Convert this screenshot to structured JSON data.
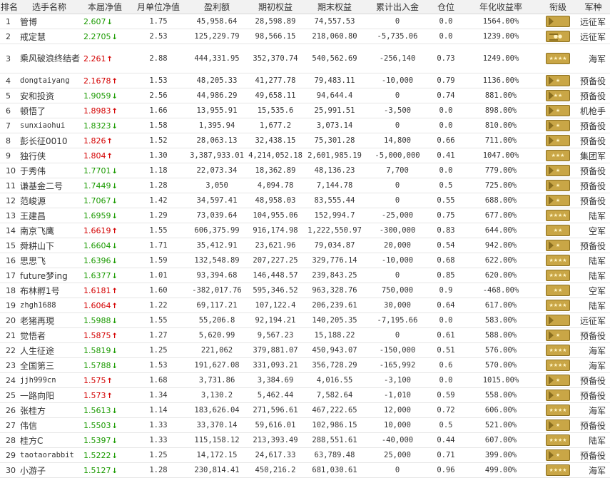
{
  "columns": [
    "排名",
    "选手名称",
    "本届净值",
    "月单位净值",
    "盈利额",
    "期初权益",
    "期末权益",
    "累计出入金",
    "仓位",
    "年化收益率",
    "衔级",
    "军种"
  ],
  "rows": [
    {
      "rank": "1",
      "name": "管博",
      "nav": "2.607",
      "dir": "down",
      "monthly": "1.75",
      "profit": "45,958.64",
      "start": "28,598.89",
      "end": "74,557.53",
      "flow": "0",
      "position": "0.0",
      "annual": "1564.00%",
      "badge": "chev-plain",
      "corps": "远征军"
    },
    {
      "rank": "2",
      "name": "戒定慧",
      "nav": "2.2705",
      "dir": "down",
      "monthly": "2.53",
      "profit": "125,229.79",
      "start": "98,566.15",
      "end": "218,060.80",
      "flow": "-5,735.06",
      "position": "0.0",
      "annual": "1239.00%",
      "badge": "bars-2",
      "corps": "远征军"
    },
    {
      "rank": "3",
      "name": "乘风破浪终结者",
      "nav": "2.261",
      "dir": "up",
      "monthly": "2.88",
      "profit": "444,331.95",
      "start": "352,370.74",
      "end": "540,562.69",
      "flow": "-256,140",
      "position": "0.73",
      "annual": "1249.00%",
      "badge": "stars-4",
      "corps": "海军",
      "tall": true
    },
    {
      "rank": "4",
      "name": "dongtaiyang",
      "nav": "2.1678",
      "dir": "up",
      "monthly": "1.53",
      "profit": "48,205.33",
      "start": "41,277.78",
      "end": "79,483.11",
      "flow": "-10,000",
      "position": "0.79",
      "annual": "1136.00%",
      "badge": "chev-1",
      "corps": "预备役",
      "latin": true
    },
    {
      "rank": "5",
      "name": "安和投资",
      "nav": "1.9059",
      "dir": "down",
      "monthly": "2.56",
      "profit": "44,986.29",
      "start": "49,658.11",
      "end": "94,644.4",
      "flow": "0",
      "position": "0.74",
      "annual": "881.00%",
      "badge": "chev-2",
      "corps": "预备役"
    },
    {
      "rank": "6",
      "name": "顿悟了",
      "nav": "1.8983",
      "dir": "up",
      "monthly": "1.66",
      "profit": "13,955.91",
      "start": "15,535.6",
      "end": "25,991.51",
      "flow": "-3,500",
      "position": "0.0",
      "annual": "898.00%",
      "badge": "chev-1",
      "corps": "机枪手"
    },
    {
      "rank": "7",
      "name": "sunxiaohui",
      "nav": "1.8323",
      "dir": "down",
      "monthly": "1.58",
      "profit": "1,395.94",
      "start": "1,677.2",
      "end": "3,073.14",
      "flow": "0",
      "position": "0.0",
      "annual": "810.00%",
      "badge": "chev-1",
      "corps": "预备役",
      "latin": true
    },
    {
      "rank": "8",
      "name": "彭长征0010",
      "nav": "1.826",
      "dir": "up",
      "monthly": "1.52",
      "profit": "28,063.13",
      "start": "32,438.15",
      "end": "75,301.28",
      "flow": "14,800",
      "position": "0.66",
      "annual": "711.00%",
      "badge": "chev-1",
      "corps": "预备役"
    },
    {
      "rank": "9",
      "name": "独行侠",
      "nav": "1.804",
      "dir": "up",
      "monthly": "1.30",
      "profit": "3,387,933.01",
      "start": "4,214,052.18",
      "end": "2,601,985.19",
      "flow": "-5,000,000",
      "position": "0.41",
      "annual": "1047.00%",
      "badge": "stars-3",
      "corps": "集团军"
    },
    {
      "rank": "10",
      "name": "于秀伟",
      "nav": "1.7701",
      "dir": "down",
      "monthly": "1.18",
      "profit": "22,073.34",
      "start": "18,362.89",
      "end": "48,136.23",
      "flow": "7,700",
      "position": "0.0",
      "annual": "779.00%",
      "badge": "chev-1",
      "corps": "预备役"
    },
    {
      "rank": "11",
      "name": "谦基金二号",
      "nav": "1.7449",
      "dir": "down",
      "monthly": "1.28",
      "profit": "3,050",
      "start": "4,094.78",
      "end": "7,144.78",
      "flow": "0",
      "position": "0.5",
      "annual": "725.00%",
      "badge": "chev-1",
      "corps": "预备役"
    },
    {
      "rank": "12",
      "name": "范峻源",
      "nav": "1.7067",
      "dir": "down",
      "monthly": "1.42",
      "profit": "34,597.41",
      "start": "48,958.03",
      "end": "83,555.44",
      "flow": "0",
      "position": "0.55",
      "annual": "688.00%",
      "badge": "chev-1",
      "corps": "预备役"
    },
    {
      "rank": "13",
      "name": "王建昌",
      "nav": "1.6959",
      "dir": "down",
      "monthly": "1.29",
      "profit": "73,039.64",
      "start": "104,955.06",
      "end": "152,994.7",
      "flow": "-25,000",
      "position": "0.75",
      "annual": "677.00%",
      "badge": "stars-4",
      "corps": "陆军"
    },
    {
      "rank": "14",
      "name": "南京飞鹰",
      "nav": "1.6619",
      "dir": "up",
      "monthly": "1.55",
      "profit": "606,375.99",
      "start": "916,174.98",
      "end": "1,222,550.97",
      "flow": "-300,000",
      "position": "0.83",
      "annual": "644.00%",
      "badge": "stars-2",
      "corps": "空军"
    },
    {
      "rank": "15",
      "name": "舜耕山下",
      "nav": "1.6604",
      "dir": "down",
      "monthly": "1.71",
      "profit": "35,412.91",
      "start": "23,621.96",
      "end": "79,034.87",
      "flow": "20,000",
      "position": "0.54",
      "annual": "942.00%",
      "badge": "chev-1",
      "corps": "预备役"
    },
    {
      "rank": "16",
      "name": "思思飞",
      "nav": "1.6396",
      "dir": "down",
      "monthly": "1.59",
      "profit": "132,548.89",
      "start": "207,227.25",
      "end": "329,776.14",
      "flow": "-10,000",
      "position": "0.68",
      "annual": "622.00%",
      "badge": "stars-4",
      "corps": "陆军"
    },
    {
      "rank": "17",
      "name": "future梦ing",
      "nav": "1.6377",
      "dir": "down",
      "monthly": "1.01",
      "profit": "93,394.68",
      "start": "146,448.57",
      "end": "239,843.25",
      "flow": "0",
      "position": "0.85",
      "annual": "620.00%",
      "badge": "stars-4",
      "corps": "陆军"
    },
    {
      "rank": "18",
      "name": "布林孵1号",
      "nav": "1.6181",
      "dir": "up",
      "monthly": "1.60",
      "profit": "-382,017.76",
      "start": "595,346.52",
      "end": "963,328.76",
      "flow": "750,000",
      "position": "0.9",
      "annual": "-468.00%",
      "badge": "stars-2",
      "corps": "空军"
    },
    {
      "rank": "19",
      "name": "zhgh1688",
      "nav": "1.6064",
      "dir": "up",
      "monthly": "1.22",
      "profit": "69,117.21",
      "start": "107,122.4",
      "end": "206,239.61",
      "flow": "30,000",
      "position": "0.64",
      "annual": "617.00%",
      "badge": "stars-4",
      "corps": "陆军",
      "latin": true
    },
    {
      "rank": "20",
      "name": "老猪再現",
      "nav": "1.5988",
      "dir": "down",
      "monthly": "1.55",
      "profit": "55,206.8",
      "start": "92,194.21",
      "end": "140,205.35",
      "flow": "-7,195.66",
      "position": "0.0",
      "annual": "583.00%",
      "badge": "chev-plain",
      "corps": "远征军"
    },
    {
      "rank": "21",
      "name": "觉悟者",
      "nav": "1.5875",
      "dir": "up",
      "monthly": "1.27",
      "profit": "5,620.99",
      "start": "9,567.23",
      "end": "15,188.22",
      "flow": "0",
      "position": "0.61",
      "annual": "588.00%",
      "badge": "chev-1",
      "corps": "预备役"
    },
    {
      "rank": "22",
      "name": "人生征途",
      "nav": "1.5819",
      "dir": "down",
      "monthly": "1.25",
      "profit": "221,062",
      "start": "379,881.07",
      "end": "450,943.07",
      "flow": "-150,000",
      "position": "0.51",
      "annual": "576.00%",
      "badge": "stars-4",
      "corps": "海军"
    },
    {
      "rank": "23",
      "name": "全国第三",
      "nav": "1.5788",
      "dir": "down",
      "monthly": "1.53",
      "profit": "191,627.08",
      "start": "331,093.21",
      "end": "356,728.29",
      "flow": "-165,992",
      "position": "0.6",
      "annual": "570.00%",
      "badge": "stars-4",
      "corps": "海军"
    },
    {
      "rank": "24",
      "name": "jjh999cn",
      "nav": "1.575",
      "dir": "up",
      "monthly": "1.68",
      "profit": "3,731.86",
      "start": "3,384.69",
      "end": "4,016.55",
      "flow": "-3,100",
      "position": "0.0",
      "annual": "1015.00%",
      "badge": "chev-1",
      "corps": "预备役",
      "latin": true
    },
    {
      "rank": "25",
      "name": "一路向阳",
      "nav": "1.573",
      "dir": "up",
      "monthly": "1.34",
      "profit": "3,130.2",
      "start": "5,462.44",
      "end": "7,582.64",
      "flow": "-1,010",
      "position": "0.59",
      "annual": "558.00%",
      "badge": "chev-1",
      "corps": "预备役"
    },
    {
      "rank": "26",
      "name": "张桂方",
      "nav": "1.5613",
      "dir": "down",
      "monthly": "1.14",
      "profit": "183,626.04",
      "start": "271,596.61",
      "end": "467,222.65",
      "flow": "12,000",
      "position": "0.72",
      "annual": "606.00%",
      "badge": "stars-4",
      "corps": "海军"
    },
    {
      "rank": "27",
      "name": "伟信",
      "nav": "1.5503",
      "dir": "down",
      "monthly": "1.33",
      "profit": "33,370.14",
      "start": "59,616.01",
      "end": "102,986.15",
      "flow": "10,000",
      "position": "0.5",
      "annual": "521.00%",
      "badge": "chev-1",
      "corps": "预备役"
    },
    {
      "rank": "28",
      "name": "桂方C",
      "nav": "1.5397",
      "dir": "down",
      "monthly": "1.33",
      "profit": "115,158.12",
      "start": "213,393.49",
      "end": "288,551.61",
      "flow": "-40,000",
      "position": "0.44",
      "annual": "607.00%",
      "badge": "stars-4",
      "corps": "陆军"
    },
    {
      "rank": "29",
      "name": "taotaorabbit",
      "nav": "1.5222",
      "dir": "down",
      "monthly": "1.25",
      "profit": "14,172.15",
      "start": "24,617.33",
      "end": "63,789.48",
      "flow": "25,000",
      "position": "0.71",
      "annual": "399.00%",
      "badge": "chev-1",
      "corps": "预备役",
      "latin": true
    },
    {
      "rank": "30",
      "name": "小游子",
      "nav": "1.5127",
      "dir": "down",
      "monthly": "1.28",
      "profit": "230,814.41",
      "start": "450,216.2",
      "end": "681,030.61",
      "flow": "0",
      "position": "0.96",
      "annual": "499.00%",
      "badge": "stars-4",
      "corps": "海军"
    }
  ],
  "colors": {
    "up": "#d40000",
    "down": "#1a9a00",
    "badge_gold": "#c9a646"
  },
  "icons": {
    "up": "arrow-up-icon",
    "down": "arrow-down-icon"
  }
}
